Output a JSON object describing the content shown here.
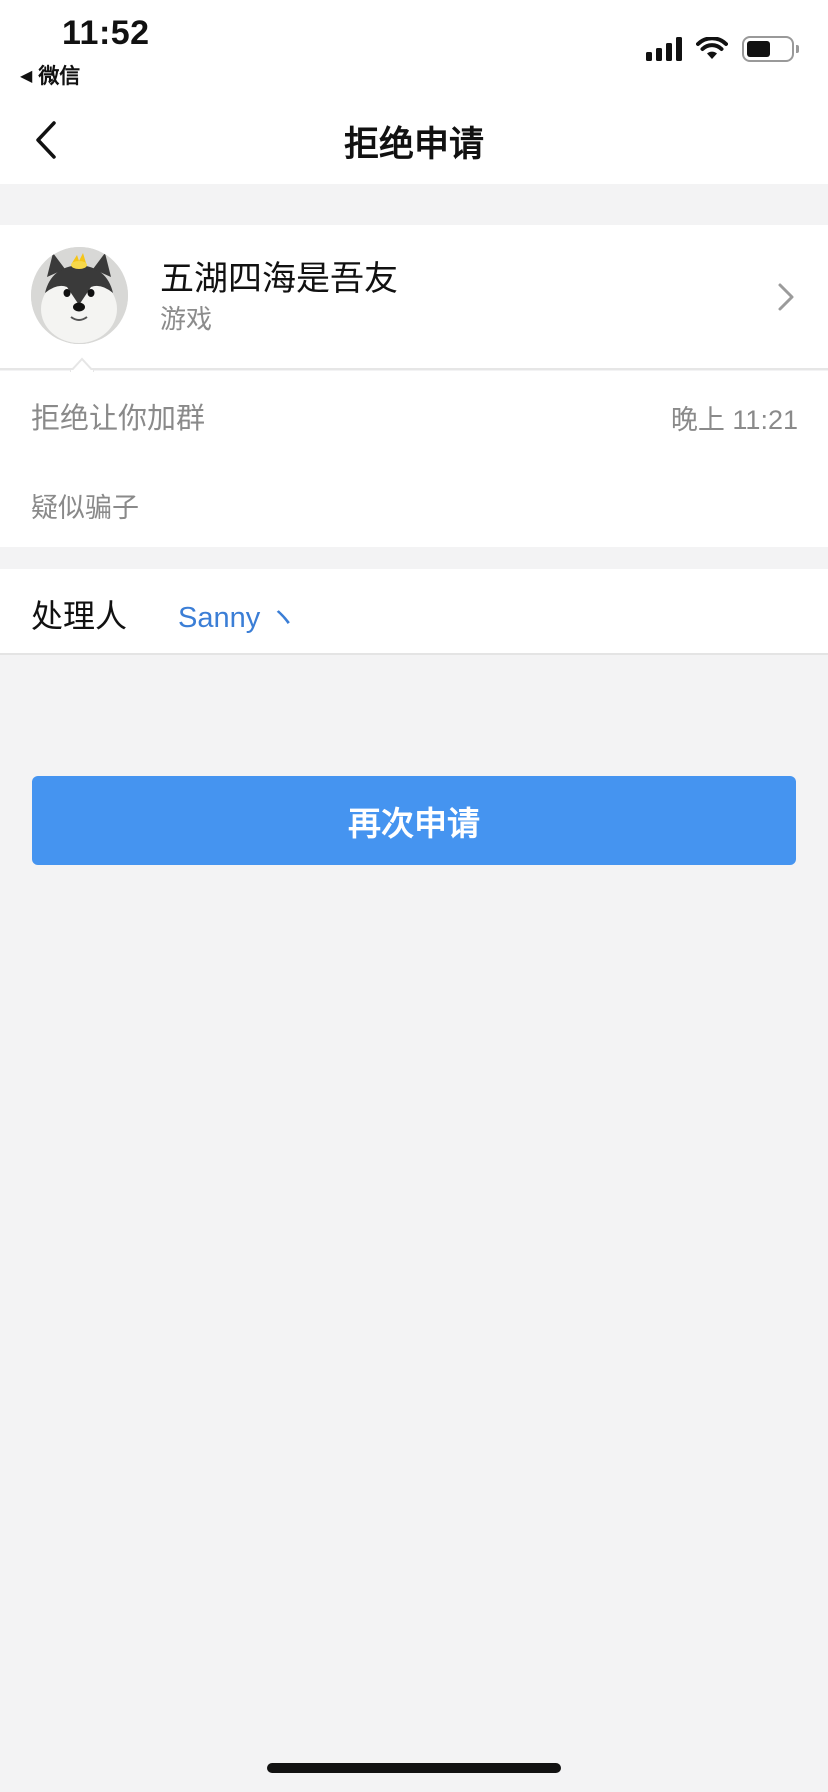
{
  "status_bar": {
    "time": "11:52",
    "back_app": "微信",
    "back_arrow": "◀",
    "icons": [
      "signal-icon",
      "wifi-icon",
      "battery-icon"
    ]
  },
  "nav": {
    "title": "拒绝申请",
    "back_icon": "chevron-left-icon"
  },
  "group": {
    "name": "五湖四海是吾友",
    "category": "游戏",
    "avatar": "husky-dog-avatar",
    "chevron_icon": "chevron-right-icon"
  },
  "rejection": {
    "title": "拒绝让你加群",
    "time": "晚上 11:21",
    "reason": "疑似骗子"
  },
  "handler": {
    "label": "处理人",
    "name": "Sanny ヽ"
  },
  "actions": {
    "reapply_label": "再次申请"
  },
  "colors": {
    "page_background": "#f3f3f4",
    "accent_blue": "#4594f0",
    "link_blue": "#3b7ed6",
    "muted_text": "#8a8a8a"
  }
}
